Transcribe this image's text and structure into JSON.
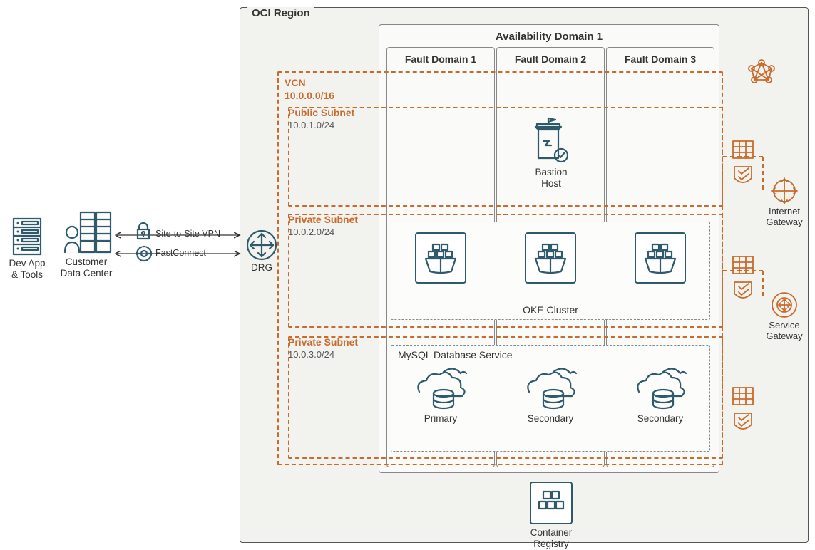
{
  "region": {
    "title": "OCI Region"
  },
  "availability_domain": {
    "title": "Availability Domain 1"
  },
  "fault_domains": [
    "Fault Domain 1",
    "Fault Domain 2",
    "Fault Domain 3"
  ],
  "vcn": {
    "label": "VCN",
    "cidr": "10.0.0.0/16"
  },
  "subnets": {
    "public": {
      "name": "Public Subnet",
      "cidr": "10.0.1.0/24"
    },
    "private1": {
      "name": "Private Subnet",
      "cidr": "10.0.2.0/24"
    },
    "private2": {
      "name": "Private Subnet",
      "cidr": "10.0.3.0/24"
    }
  },
  "oke_cluster": {
    "title": "OKE Cluster"
  },
  "mysql": {
    "title": "MySQL Database Service",
    "nodes": [
      "Primary",
      "Secondary",
      "Secondary"
    ]
  },
  "bastion": {
    "label": "Bastion\nHost"
  },
  "container_registry": {
    "label": "Container\nRegistry"
  },
  "left_side": {
    "dev": "Dev App\n& Tools",
    "customer": "Customer\nData Center"
  },
  "gateways": {
    "drg": "DRG",
    "internet": "Internet\nGateway",
    "service": "Service\nGateway"
  },
  "connections": {
    "vpn": "Site-to-Site VPN",
    "fastconnect": "FastConnect"
  }
}
